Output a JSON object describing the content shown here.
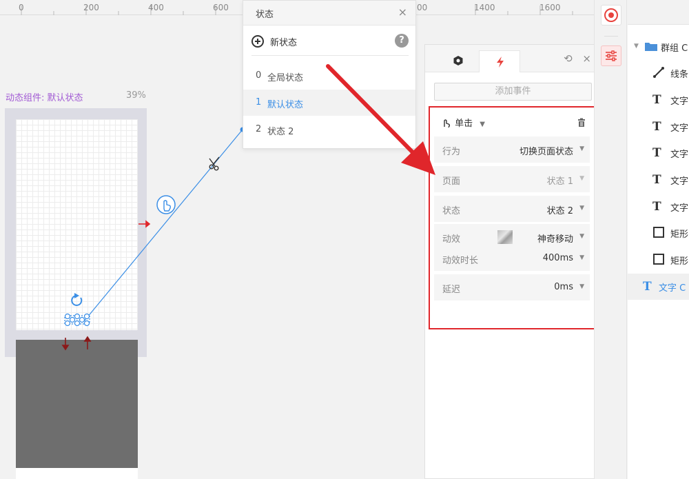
{
  "ruler": {
    "labels": [
      "0",
      "200",
      "400",
      "600",
      "00",
      "1400",
      "1600"
    ]
  },
  "canvas": {
    "frame_title": "动态组件: 默认状态",
    "zoom": "39%",
    "scissors_icon": "scissors-icon",
    "tap_icon": "tap-hand-icon",
    "refresh_icon": "refresh-icon",
    "colors": {
      "link": "#3a8ee6",
      "annotation_arrow": "#e0262b",
      "frame_title": "#a25bd4"
    }
  },
  "states_panel": {
    "title": "状态",
    "close": "×",
    "new_state": "新状态",
    "help": "?",
    "items": [
      {
        "num": "0",
        "name": "全局状态"
      },
      {
        "num": "1",
        "name": "默认状态"
      },
      {
        "num": "2",
        "name": "状态 2"
      }
    ]
  },
  "interaction_panel": {
    "tools": {
      "magnet": "⟲",
      "close": "×"
    },
    "add_event": "添加事件",
    "event": {
      "trigger": "单击",
      "rows": [
        {
          "label": "行为",
          "value": "切换页面状态"
        },
        {
          "label": "页面",
          "value": "状态 1"
        },
        {
          "label": "状态",
          "value": "状态 2"
        },
        {
          "label": "动效",
          "value": "神奇移动"
        },
        {
          "label": "动效时长",
          "value": "400ms"
        },
        {
          "label": "延迟",
          "value": "0ms"
        }
      ]
    }
  },
  "layers": {
    "items": [
      {
        "icon": "folder-icon",
        "label": "群组 C"
      },
      {
        "icon": "line-icon",
        "label": "线条"
      },
      {
        "icon": "text-icon",
        "label": "文字"
      },
      {
        "icon": "text-icon",
        "label": "文字"
      },
      {
        "icon": "text-icon",
        "label": "文字"
      },
      {
        "icon": "text-icon",
        "label": "文字"
      },
      {
        "icon": "text-icon",
        "label": "文字"
      },
      {
        "icon": "rect-icon",
        "label": "矩形"
      },
      {
        "icon": "rect-icon",
        "label": "矩形"
      },
      {
        "icon": "text-icon",
        "label": "文字 C"
      }
    ]
  }
}
